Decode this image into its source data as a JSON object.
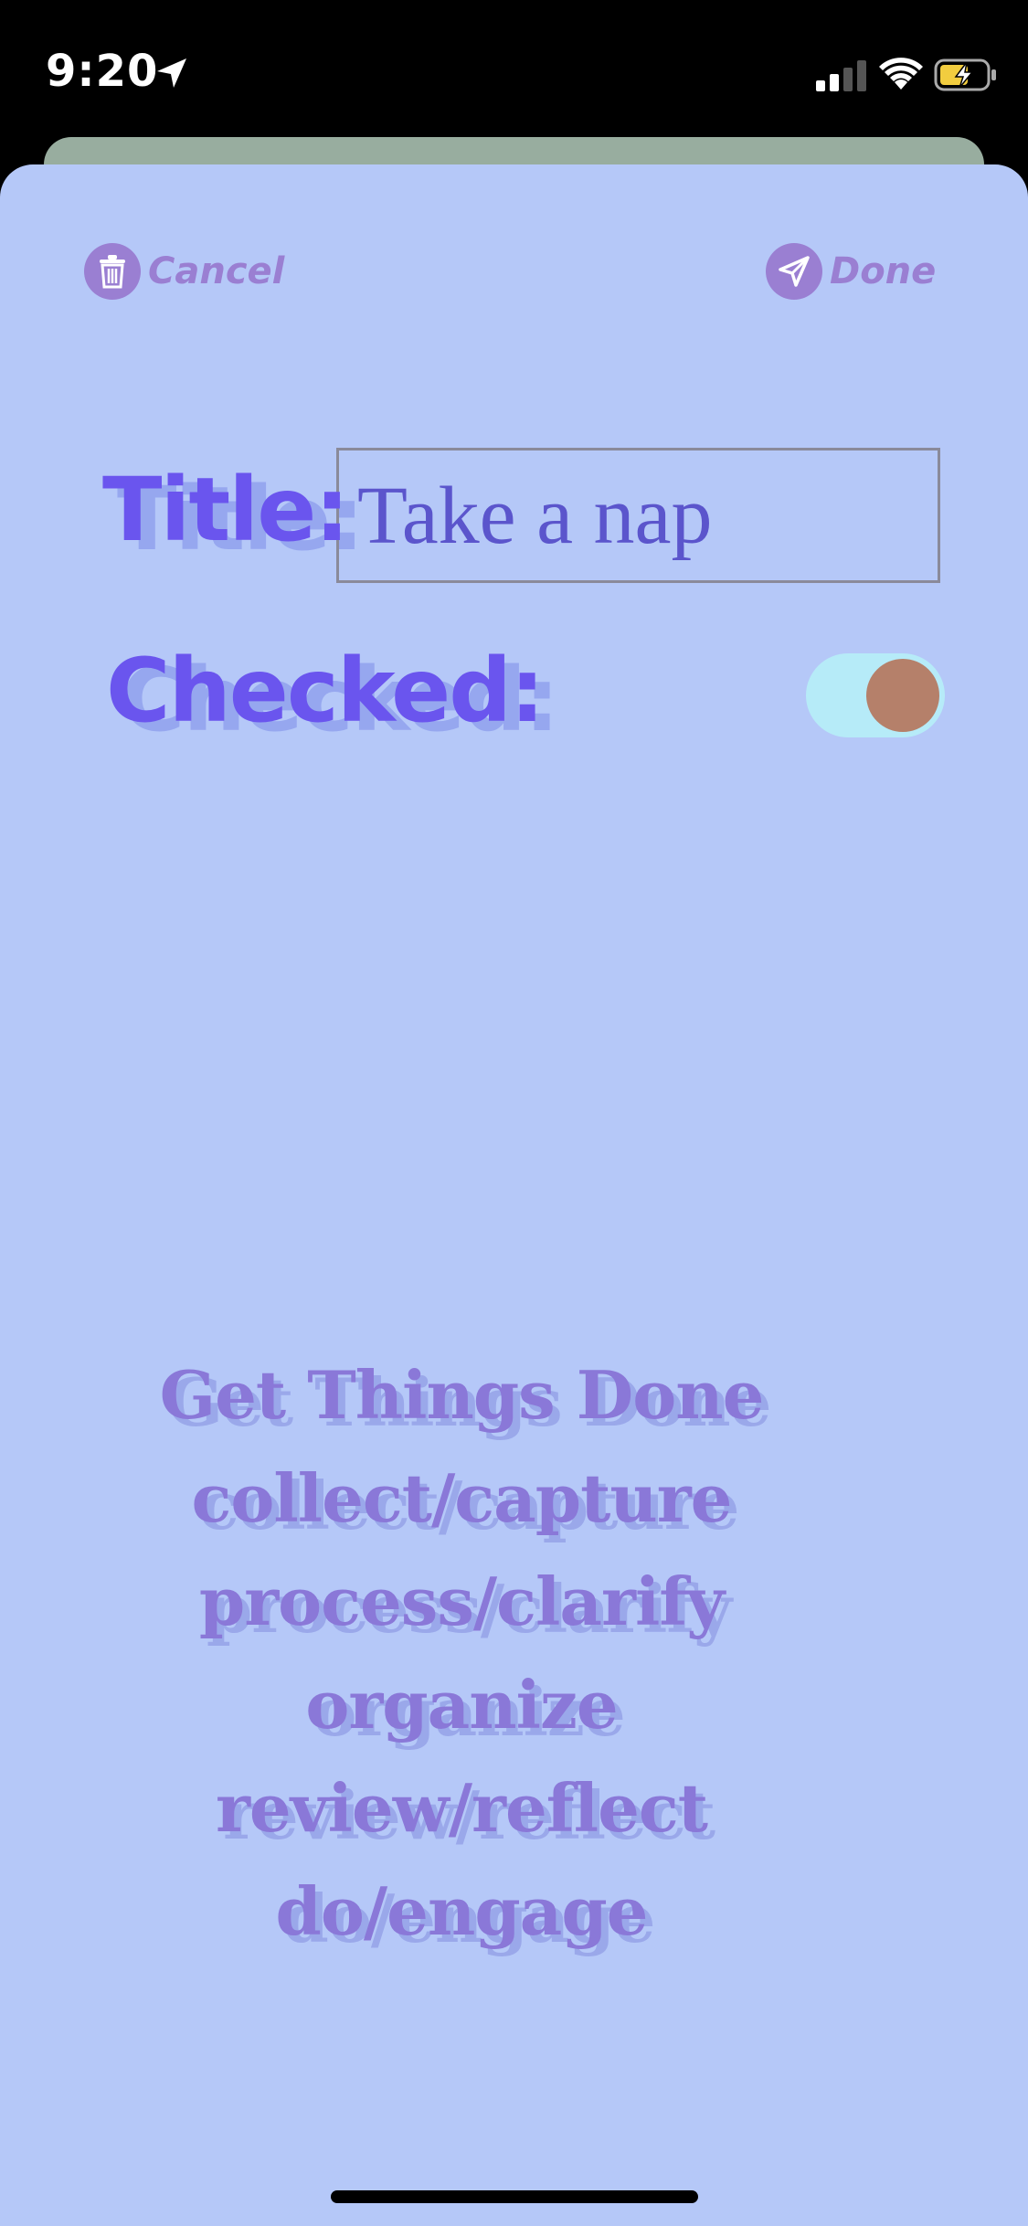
{
  "status_bar": {
    "time": "9:20"
  },
  "nav": {
    "cancel_label": "Cancel",
    "done_label": "Done"
  },
  "form": {
    "title_label": "Title:",
    "title_value": "Take a nap",
    "checked_label": "Checked:",
    "checked": true
  },
  "gtd": {
    "lines": [
      "Get Things Done",
      "collect/capture",
      "process/clarify",
      "organize",
      "review/reflect",
      "do/engage"
    ]
  },
  "colors": {
    "sheet_bg": "#b5c8f8",
    "accent_purple": "#9a7fd2",
    "label_purple": "#6a55ee",
    "toggle_track": "#b6ebf8",
    "toggle_knob": "#b5806a"
  },
  "icons": {
    "location": "location-arrow-icon",
    "signal": "cellular-signal-icon",
    "wifi": "wifi-icon",
    "battery": "battery-charging-icon",
    "cancel": "trash-icon",
    "done": "paper-plane-icon"
  }
}
